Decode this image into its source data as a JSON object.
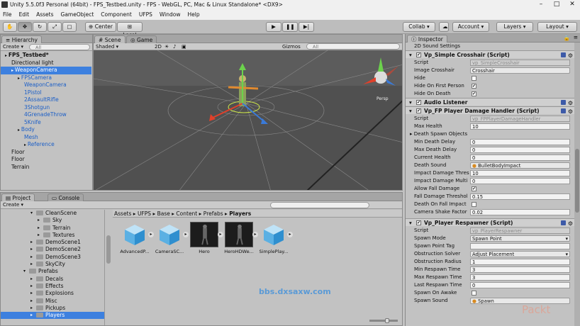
{
  "window": {
    "title": "Unity 5.5.0f3 Personal (64bit) - FPS_Testbed.unity - FPS - WebGL, PC, Mac & Linux Standalone* <DX9>"
  },
  "menu": [
    "File",
    "Edit",
    "Assets",
    "GameObject",
    "Component",
    "UFPS",
    "Window",
    "Help"
  ],
  "toolbar": {
    "center": "Center",
    "local": "Local",
    "collab": "Collab",
    "account": "Account",
    "layers": "Layers",
    "layout": "Layout"
  },
  "hierarchy": {
    "tab": "Hierarchy",
    "create": "Create",
    "search": "All",
    "items": [
      {
        "label": "FPS_Testbed*",
        "indent": 0,
        "blue": false,
        "bold": true,
        "sel": false,
        "arrow": true
      },
      {
        "label": "Directional light",
        "indent": 1,
        "blue": false,
        "sel": false
      },
      {
        "label": "WeaponCamera",
        "indent": 1,
        "blue": true,
        "sel": true,
        "arrow": true
      },
      {
        "label": "FPSCamera",
        "indent": 2,
        "blue": true,
        "sel": false,
        "arrow": true
      },
      {
        "label": "WeaponCamera",
        "indent": 3,
        "blue": true,
        "sel": false
      },
      {
        "label": "1Pistol",
        "indent": 3,
        "blue": true,
        "sel": false
      },
      {
        "label": "2AssaultRifle",
        "indent": 3,
        "blue": true,
        "sel": false
      },
      {
        "label": "3Shotgun",
        "indent": 3,
        "blue": true,
        "sel": false
      },
      {
        "label": "4GrenadeThrow",
        "indent": 3,
        "blue": true,
        "sel": false
      },
      {
        "label": "5Knife",
        "indent": 3,
        "blue": true,
        "sel": false
      },
      {
        "label": "Body",
        "indent": 2,
        "blue": true,
        "sel": false,
        "arrow": true
      },
      {
        "label": "Mesh",
        "indent": 3,
        "blue": true,
        "sel": false
      },
      {
        "label": "Reference",
        "indent": 3,
        "blue": true,
        "sel": false,
        "arrow": true
      },
      {
        "label": "Floor",
        "indent": 1,
        "blue": false,
        "sel": false
      },
      {
        "label": "Floor",
        "indent": 1,
        "blue": false,
        "sel": false
      },
      {
        "label": "Terrain",
        "indent": 1,
        "blue": false,
        "sel": false
      }
    ]
  },
  "scene": {
    "tab": "Scene",
    "game_tab": "Game",
    "shading": "Shaded",
    "mode2d": "2D",
    "gizmos": "Gizmos",
    "search": "All",
    "persp": "Persp"
  },
  "project": {
    "tab": "Project",
    "console_tab": "Console",
    "create": "Create",
    "folders": [
      {
        "label": "CleanScene",
        "indent": 1,
        "open": true
      },
      {
        "label": "Sky",
        "indent": 2
      },
      {
        "label": "Terrain",
        "indent": 2
      },
      {
        "label": "Textures",
        "indent": 2
      },
      {
        "label": "DemoScene1",
        "indent": 1
      },
      {
        "label": "DemoScene2",
        "indent": 1
      },
      {
        "label": "DemoScene3",
        "indent": 1
      },
      {
        "label": "SkyCity",
        "indent": 1
      },
      {
        "label": "Prefabs",
        "indent": 0,
        "open": true
      },
      {
        "label": "Decals",
        "indent": 1
      },
      {
        "label": "Effects",
        "indent": 1
      },
      {
        "label": "Explosions",
        "indent": 1
      },
      {
        "label": "Misc",
        "indent": 1
      },
      {
        "label": "Pickups",
        "indent": 1
      },
      {
        "label": "Players",
        "indent": 1,
        "sel": true
      }
    ],
    "breadcrumb": [
      "Assets",
      "UFPS",
      "Base",
      "Content",
      "Prefabs",
      "Players"
    ],
    "assets": [
      {
        "label": "AdvancedP...",
        "kind": "cube"
      },
      {
        "label": "CameraSC...",
        "kind": "cube"
      },
      {
        "label": "Hero",
        "kind": "figure"
      },
      {
        "label": "HeroHDWe...",
        "kind": "figure"
      },
      {
        "label": "SimplePlay...",
        "kind": "cube"
      }
    ]
  },
  "inspector": {
    "tab": "Inspector",
    "sound_settings": "2D Sound Settings",
    "crosshair": {
      "title": "Vp_Simple Crosshair (Script)",
      "script_label": "Script",
      "script_val": "vp_SimpleCrosshair",
      "image_label": "Image Crosshair",
      "image_val": "Crosshair",
      "hide_label": "Hide",
      "hide_fp_label": "Hide On First Person",
      "hide_death_label": "Hide On Death"
    },
    "audio": {
      "title": "Audio Listener"
    },
    "damage": {
      "title": "Vp_FP Player Damage Handler (Script)",
      "script_label": "Script",
      "script_val": "vp_FPPlayerDamageHandler",
      "rows": [
        {
          "label": "Max Health",
          "value": "10",
          "type": "num"
        },
        {
          "label": "Death Spawn Objects",
          "value": "",
          "type": "fold"
        },
        {
          "label": "Min Death Delay",
          "value": "0",
          "type": "num"
        },
        {
          "label": "Max Death Delay",
          "value": "0",
          "type": "num"
        },
        {
          "label": "Current Health",
          "value": "0",
          "type": "num"
        },
        {
          "label": "Death Sound",
          "value": "BulletBodyImpact",
          "type": "obj"
        },
        {
          "label": "Impact Damage Thres",
          "value": "10",
          "type": "num"
        },
        {
          "label": "Impact Damage Multi",
          "value": "0",
          "type": "num"
        },
        {
          "label": "Allow Fall Damage",
          "value": "",
          "type": "check_on"
        },
        {
          "label": "Fall Damage Threshol",
          "value": "0.15",
          "type": "num"
        },
        {
          "label": "Death On Fall Impact",
          "value": "",
          "type": "check_off"
        },
        {
          "label": "Camera Shake Factor",
          "value": "0.02",
          "type": "num"
        }
      ]
    },
    "respawner": {
      "title": "Vp_Player Respawner (Script)",
      "script_label": "Script",
      "script_val": "vp_PlayerRespawner",
      "rows": [
        {
          "label": "Spawn Mode",
          "value": "Spawn Point",
          "type": "select"
        },
        {
          "label": "Spawn Point Tag",
          "value": "",
          "type": "blank"
        },
        {
          "label": "Obstruction Solver",
          "value": "Adjust Placement",
          "type": "select"
        },
        {
          "label": "Obstruction Radius",
          "value": "1",
          "type": "num"
        },
        {
          "label": "Min Respawn Time",
          "value": "3",
          "type": "num"
        },
        {
          "label": "Max Respawn Time",
          "value": "3",
          "type": "num"
        },
        {
          "label": "Last Respawn Time",
          "value": "0",
          "type": "num"
        },
        {
          "label": "Spawn On Awake",
          "value": "",
          "type": "check_off"
        },
        {
          "label": "Spawn Sound",
          "value": "Spawn",
          "type": "obj"
        }
      ]
    }
  },
  "watermark": {
    "site": "bbs.dxsaxw.com",
    "brand": "Packt"
  }
}
